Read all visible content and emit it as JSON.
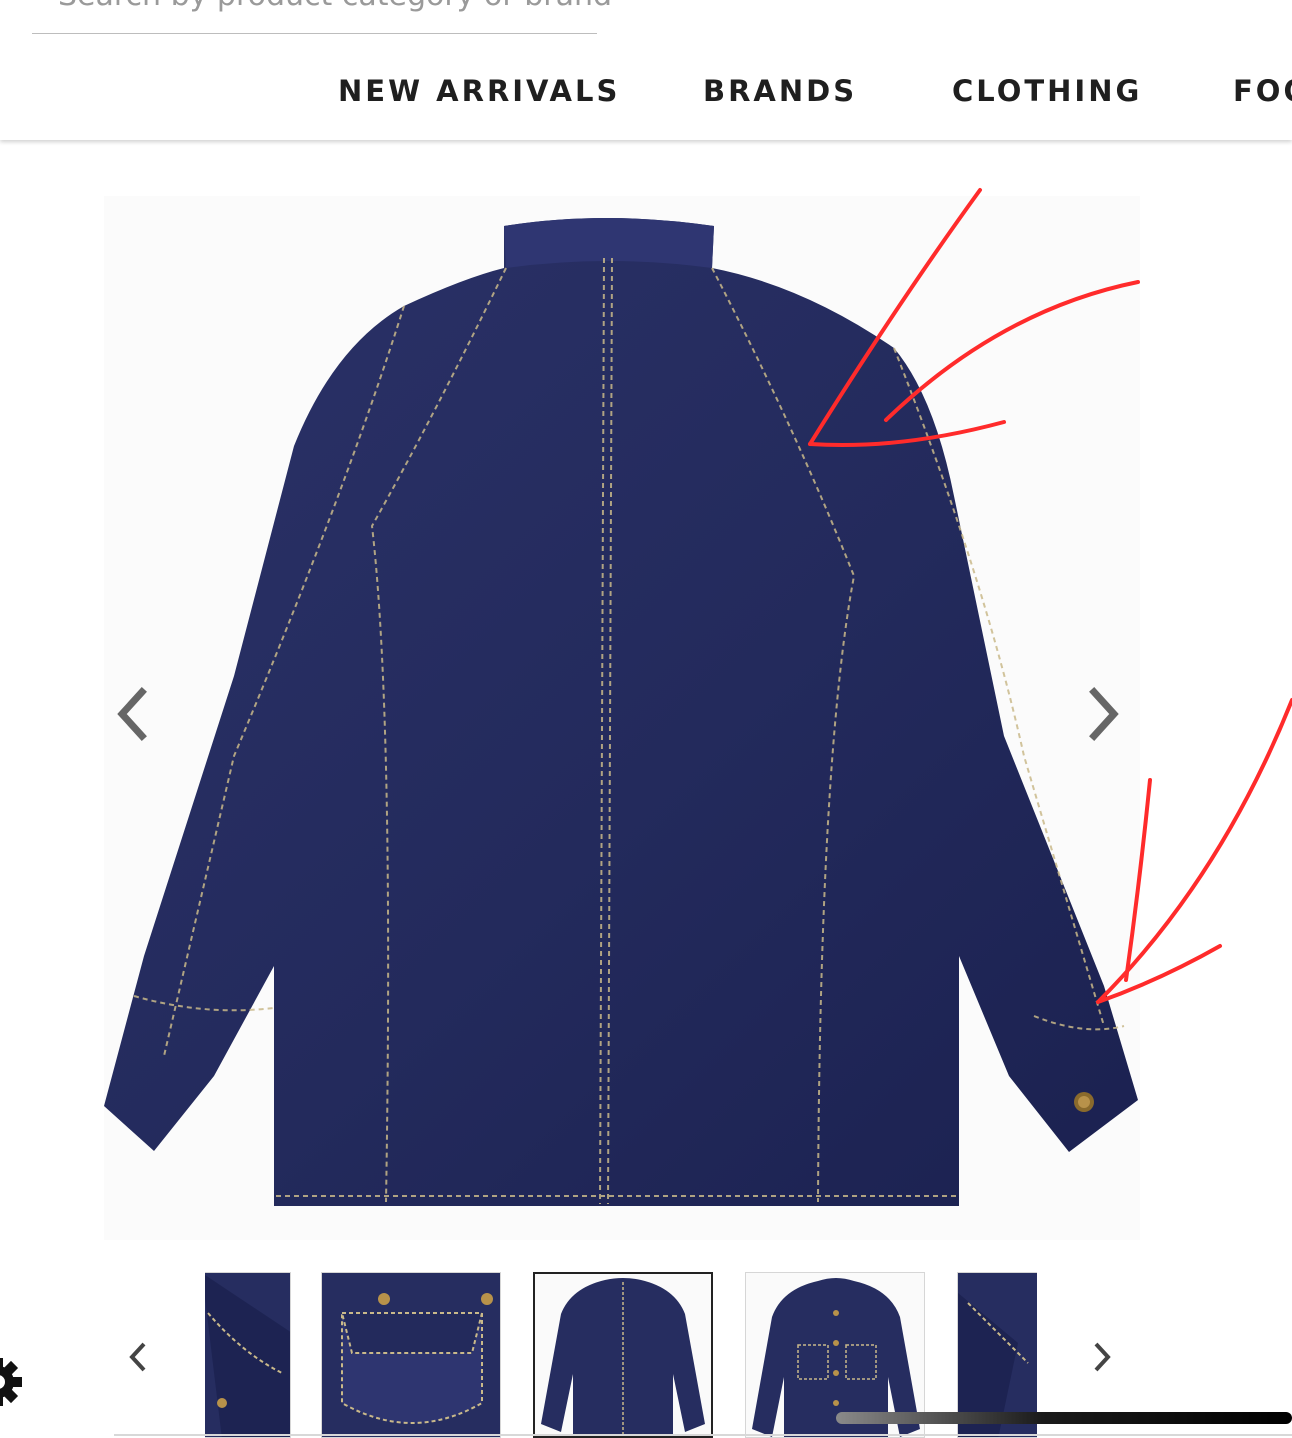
{
  "search": {
    "partial_text": "Search by product category or brand"
  },
  "nav": {
    "items": [
      {
        "label": "NEW ARRIVALS"
      },
      {
        "label": "BRANDS"
      },
      {
        "label": "CLOTHING"
      },
      {
        "label": "FOO"
      }
    ]
  },
  "gallery": {
    "main_image": {
      "subject": "denim-chore-jacket-back-view"
    },
    "prev_icon": "chevron-left-icon",
    "next_icon": "chevron-right-icon",
    "thumbnails": [
      {
        "subject": "sleeve-detail",
        "active": false
      },
      {
        "subject": "pocket-detail",
        "active": false
      },
      {
        "subject": "back-view",
        "active": true
      },
      {
        "subject": "front-view",
        "active": false
      },
      {
        "subject": "collar-detail",
        "active": false
      }
    ]
  },
  "annotations": {
    "color": "#ff2b2b"
  },
  "colors": {
    "denim": "#232a5c",
    "stitch": "#c9b98a",
    "accent": "#ff2b2b"
  },
  "settings_icon": "gear-icon"
}
